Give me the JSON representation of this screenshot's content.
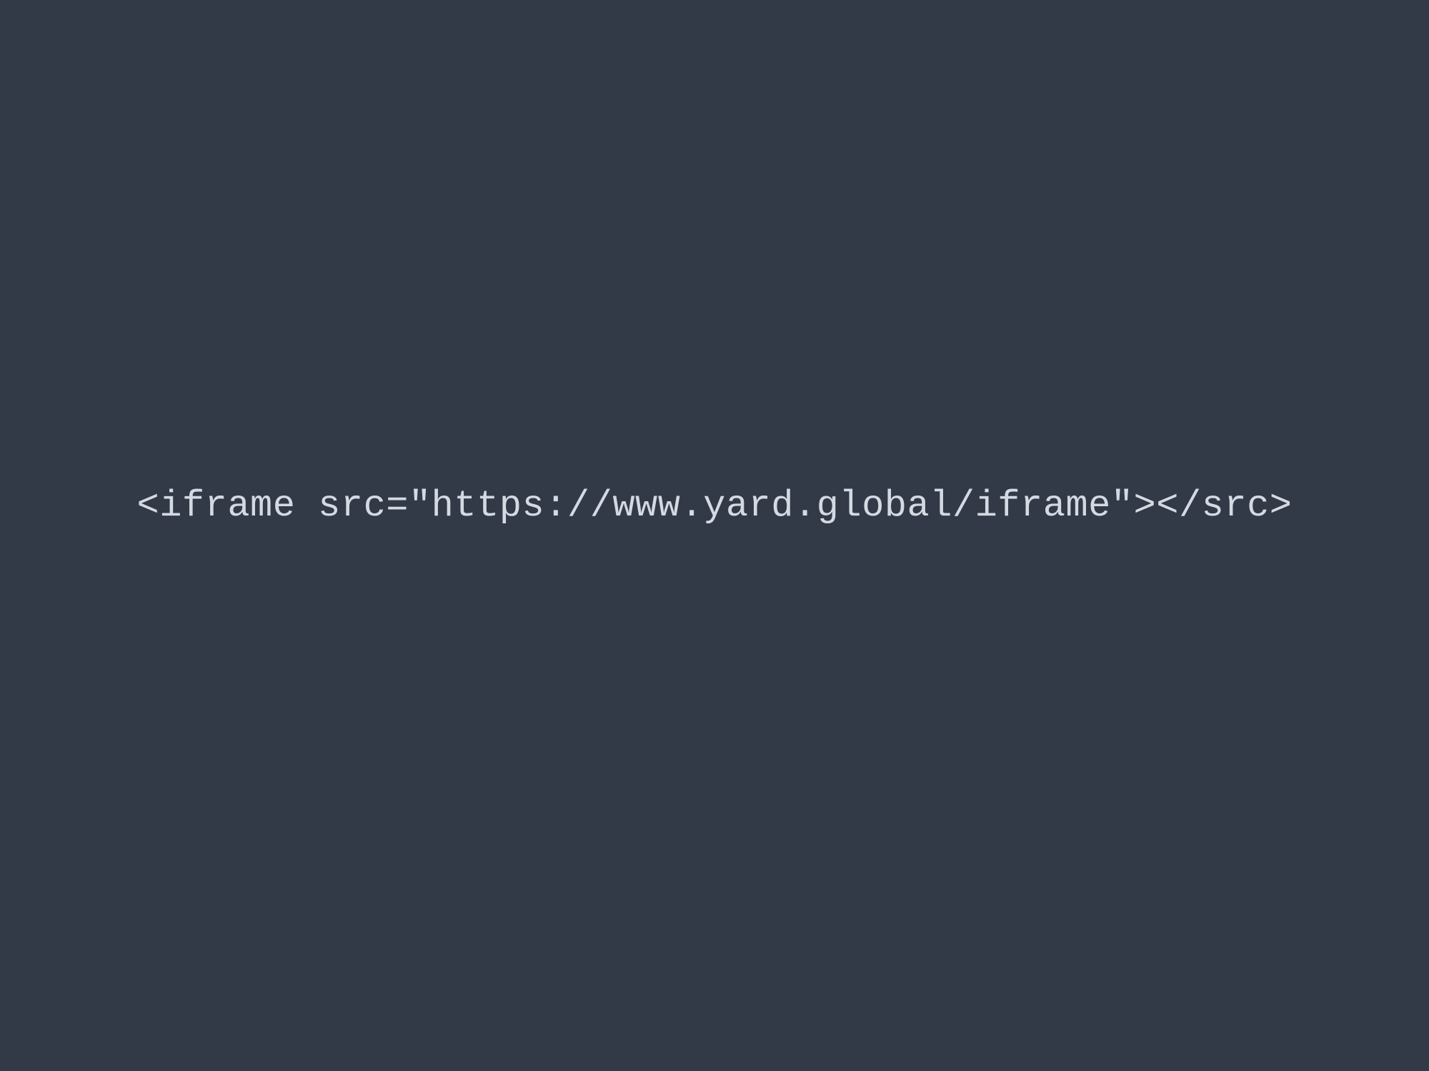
{
  "slide": {
    "code_line": "<iframe src=\"https://www.yard.global/iframe\"></src>"
  }
}
